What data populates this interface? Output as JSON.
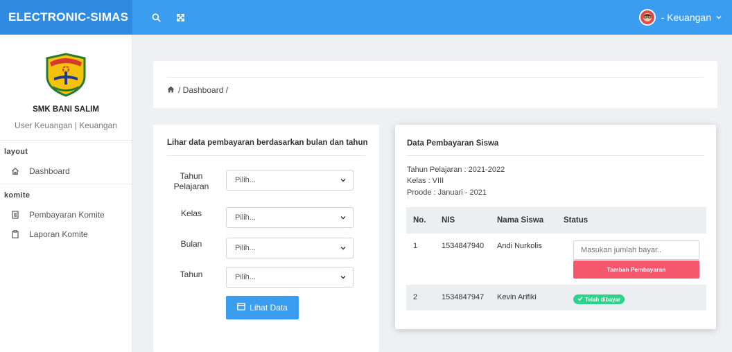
{
  "topbar": {
    "brand": "ELECTRONIC-SIMAS",
    "user_label": "- Keuangan",
    "icons": [
      "search-icon",
      "fullscreen-icon",
      "avatar",
      "chevron-down-icon"
    ],
    "colors": {
      "topbar": "#3b9df0",
      "brand_bg": "#2f8be0"
    }
  },
  "sidebar": {
    "school_name": "SMK BANI SALIM",
    "user_role": "User Keuangan | Keuangan",
    "sections": [
      {
        "title": "layout",
        "items": [
          {
            "label": "Dashboard",
            "icon": "home-icon"
          }
        ]
      },
      {
        "title": "komite",
        "items": [
          {
            "label": "Pembayaran Komite",
            "icon": "receipt-icon"
          },
          {
            "label": "Laporan Komite",
            "icon": "clipboard-icon"
          }
        ]
      }
    ]
  },
  "breadcrumb": {
    "home_icon": "home-icon",
    "text": "/ Dashboard /"
  },
  "filter": {
    "title": "Lihar data pembayaran berdasarkan bulan dan tahun",
    "fields": [
      {
        "label": "Tahun Pelajaran",
        "value": "Pilih..."
      },
      {
        "label": "Kelas",
        "value": "Pilih..."
      },
      {
        "label": "Bulan",
        "value": "Pilih..."
      },
      {
        "label": "Tahun",
        "value": "Pilih..."
      }
    ],
    "button_label": "Lihat Data"
  },
  "payments": {
    "title": "Data Pembayaran Siswa",
    "tahun": "Tahun Pelajaran : 2021-2022",
    "kelas": "Kelas : VIII",
    "periode": "Proode : Januari - 2021",
    "columns": [
      "No.",
      "NIS",
      "Nama Siswa",
      "Status"
    ],
    "rows": [
      {
        "no": "1",
        "nis": "1534847940",
        "nama": "Andi Nurkolis",
        "input_placeholder": "Masukan jumlah bayar..",
        "button": "Tambah Pembayaran"
      },
      {
        "no": "2",
        "nis": "1534847947",
        "nama": "Kevin Arifiki",
        "badge": "Telah dibayar"
      }
    ],
    "colors": {
      "pay_button": "#f5576c",
      "paid_badge": "#2bd38b"
    }
  }
}
